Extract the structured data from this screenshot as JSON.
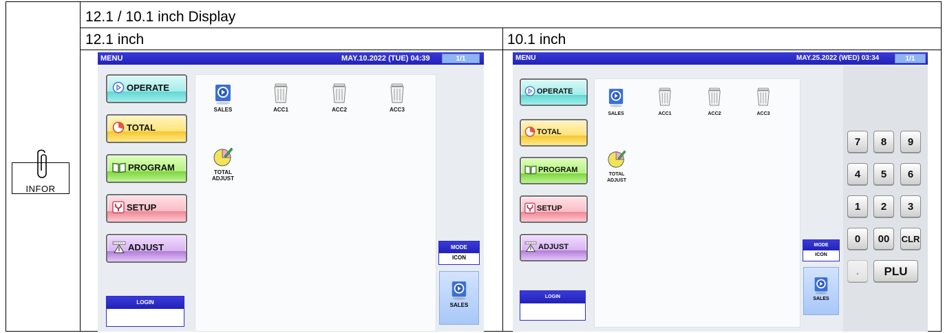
{
  "header": {
    "title": "12.1 / 10.1 inch Display"
  },
  "columns": [
    {
      "label": "12.1 inch"
    },
    {
      "label": "10.1 inch"
    }
  ],
  "infor_icon": {
    "label": "INFOR"
  },
  "screen_12": {
    "menu": "MENU",
    "date_time": "MAY.10.2022 (TUE)  04:39",
    "page": "1/1",
    "buttons": [
      "OPERATE",
      "TOTAL",
      "PROGRAM",
      "SETUP",
      "ADJUST"
    ],
    "icons": [
      "SALES",
      "ACC1",
      "ACC2",
      "ACC3"
    ],
    "total_adjust": [
      "TOTAL",
      "ADJUST"
    ],
    "login": "LOGIN",
    "mode_label": "MODE",
    "mode_value": "ICON",
    "sales_button": "SALES"
  },
  "screen_10": {
    "menu": "MENU",
    "date_time": "MAY.25.2022 (WED)  03:34",
    "page": "1/1",
    "buttons": [
      "OPERATE",
      "TOTAL",
      "PROGRAM",
      "SETUP",
      "ADJUST"
    ],
    "icons": [
      "SALES",
      "ACC1",
      "ACC2",
      "ACC3"
    ],
    "total_adjust": [
      "TOTAL",
      "ADJUST"
    ],
    "login": "LOGIN",
    "mode_label": "MODE",
    "mode_value": "ICON",
    "sales_button": "SALES",
    "keypad": [
      [
        "7",
        "8",
        "9"
      ],
      [
        "4",
        "5",
        "6"
      ],
      [
        "1",
        "2",
        "3"
      ],
      [
        "0",
        "00",
        "CLR"
      ]
    ],
    "dot_key": ".",
    "plu_key": "PLU"
  }
}
